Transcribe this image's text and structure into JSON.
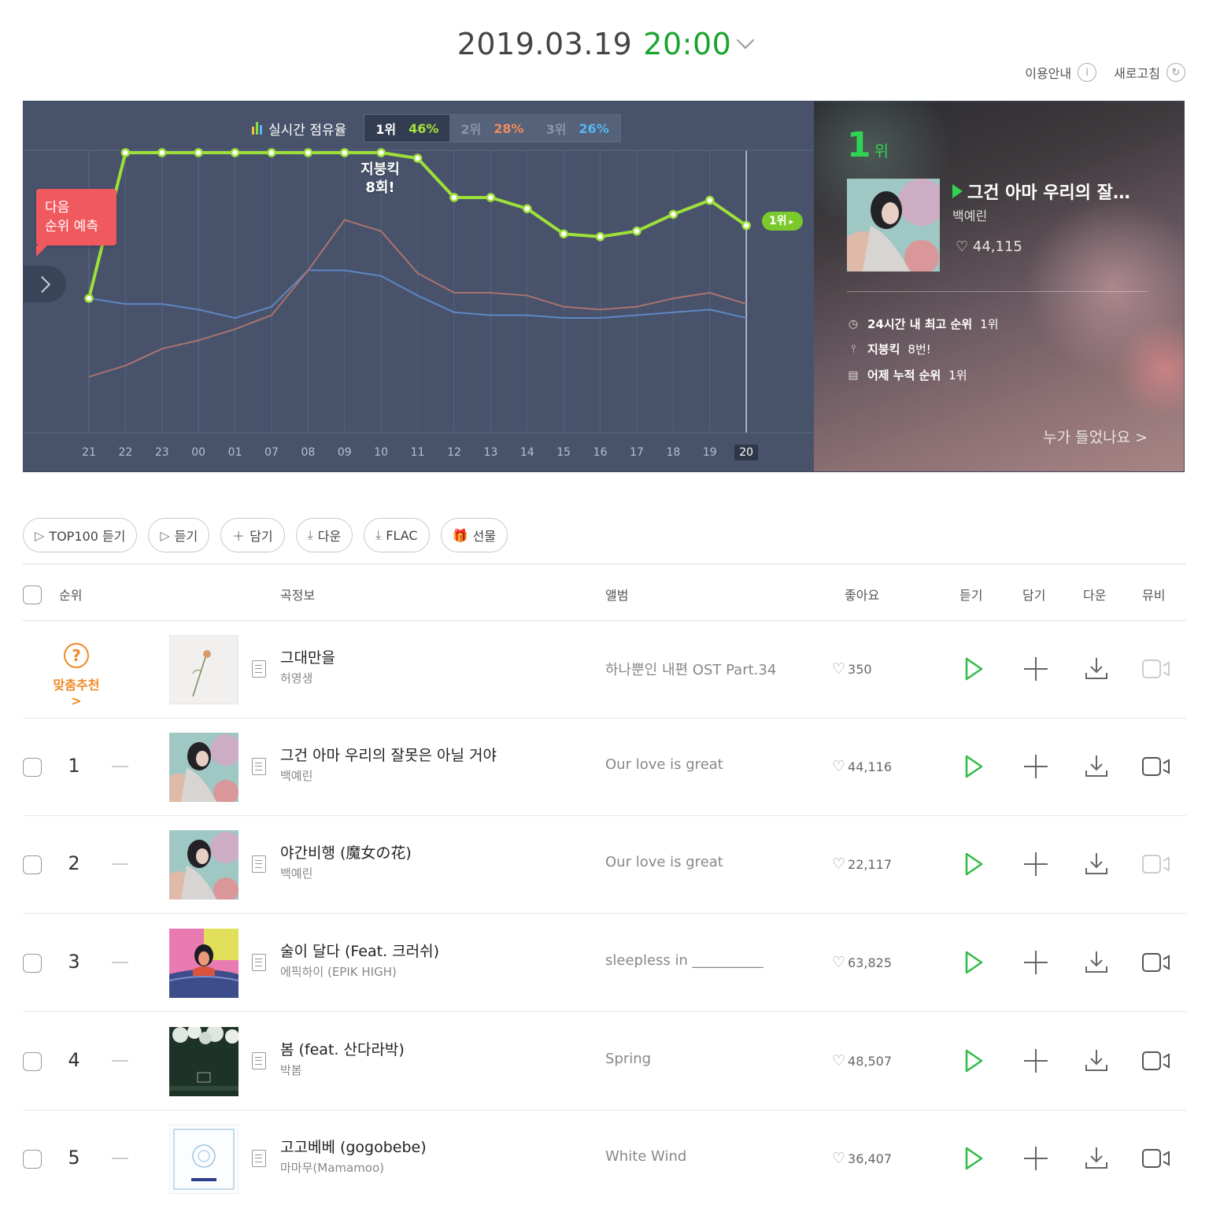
{
  "header": {
    "date": "2019.03.19",
    "time": "20:00",
    "help_label": "이용안내",
    "refresh_label": "새로고침"
  },
  "chart_panel": {
    "legend_title": "실시간 점유율",
    "tabs": [
      {
        "rank": "1위",
        "pct": "46%"
      },
      {
        "rank": "2위",
        "pct": "28%"
      },
      {
        "rank": "3위",
        "pct": "26%"
      }
    ],
    "predict_label_1": "다음",
    "predict_label_2": "순위 예측",
    "kick_label_1": "지붕킥",
    "kick_label_2": "8회!",
    "current_badge": "1위"
  },
  "chart_data": {
    "type": "line",
    "x": [
      "21",
      "22",
      "23",
      "00",
      "01",
      "07",
      "08",
      "09",
      "10",
      "11",
      "12",
      "13",
      "14",
      "15",
      "16",
      "17",
      "18",
      "19",
      "20"
    ],
    "highlight_x": "20",
    "series": [
      {
        "color": "#9ee03a",
        "values": [
          48,
          100,
          100,
          100,
          100,
          100,
          100,
          100,
          100,
          98,
          84,
          84,
          80,
          71,
          70,
          72,
          78,
          83,
          74
        ]
      },
      {
        "color": "#a9736e",
        "values": [
          20,
          24,
          30,
          33,
          37,
          42,
          58,
          76,
          72,
          57,
          50,
          50,
          49,
          45,
          44,
          45,
          48,
          50,
          46
        ]
      },
      {
        "color": "#5f86c4",
        "values": [
          48,
          46,
          46,
          44,
          41,
          45,
          58,
          58,
          56,
          49,
          43,
          42,
          42,
          41,
          41,
          42,
          43,
          44,
          41
        ]
      }
    ],
    "ylim": [
      0,
      110
    ]
  },
  "top_song": {
    "rank_num": "1",
    "rank_unit": "위",
    "title": "그건 아마 우리의 잘…",
    "artist": "백예린",
    "likes": "44,115",
    "stat1_label": "24시간 내 최고 순위",
    "stat1_value": "1위",
    "stat2_label": "지붕킥",
    "stat2_value": "8번!",
    "stat3_label": "어제 누적 순위",
    "stat3_value": "1위",
    "who_heard": "누가 들었나요 >"
  },
  "actions": [
    "TOP100 듣기",
    "듣기",
    "담기",
    "다운",
    "FLAC",
    "선물"
  ],
  "table": {
    "headers": {
      "rank": "순위",
      "info": "곡정보",
      "album": "앨범",
      "likes": "좋아요",
      "listen": "듣기",
      "add": "담기",
      "download": "다운",
      "mv": "뮤비"
    },
    "recommend": {
      "label": "맞춤추천 >",
      "icon_char": "?",
      "title": "그대만을",
      "artist": "허영생",
      "album": "하나뿐인 내편 OST Part.34",
      "likes": "350"
    },
    "rows": [
      {
        "rank": "1",
        "title": "그건 아마 우리의 잘못은 아닐 거야",
        "artist": "백예린",
        "album": "Our love is great",
        "likes": "44,116"
      },
      {
        "rank": "2",
        "title": "야간비행 (魔女の花)",
        "artist": "백예린",
        "album": "Our love is great",
        "likes": "22,117"
      },
      {
        "rank": "3",
        "title": "술이 달다 (Feat. 크러쉬)",
        "artist": "에픽하이 (EPIK HIGH)",
        "album": "sleepless in __________",
        "likes": "63,825"
      },
      {
        "rank": "4",
        "title": "봄 (feat. 산다라박)",
        "artist": "박봄",
        "album": "Spring",
        "likes": "48,507"
      },
      {
        "rank": "5",
        "title": "고고베베 (gogobebe)",
        "artist": "마마무(Mamamoo)",
        "album": "White Wind",
        "likes": "36,407"
      }
    ]
  },
  "colors": {
    "accent_green": "#1aa42e",
    "chart_bg": "#48536b",
    "play_green": "#2fd453",
    "recommend_orange": "#ef8a27"
  }
}
